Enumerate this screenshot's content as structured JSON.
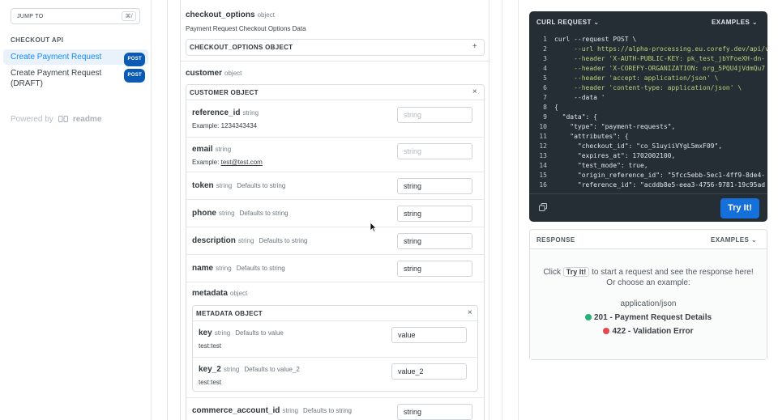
{
  "sidebar": {
    "jump_label": "JUMP TO",
    "jump_shortcut": "⌘/",
    "section": "CHECKOUT API",
    "items": [
      {
        "label": "Create Payment Request",
        "badge": "POST",
        "active": true
      },
      {
        "label": "Create Payment Request (DRAFT)",
        "badge": "POST",
        "active": false
      }
    ],
    "powered_by": "Powered by",
    "powered_brand": "readme"
  },
  "params": {
    "checkout_options": {
      "name": "checkout_options",
      "type": "object",
      "description": "Payment Request Checkout Options Data",
      "object_label": "CHECKOUT_OPTIONS OBJECT",
      "action": "+"
    },
    "customer": {
      "name": "customer",
      "type": "object",
      "object_label": "CUSTOMER OBJECT",
      "action": "×"
    },
    "customer_fields": [
      {
        "name": "reference_id",
        "type": "string",
        "default": "",
        "example_label": "Example:",
        "example": "1234343434",
        "value": "string",
        "placeholder": true
      },
      {
        "name": "email",
        "type": "string",
        "default": "",
        "example_label": "Example:",
        "example": "test@test.com",
        "value": "string",
        "placeholder": true
      },
      {
        "name": "token",
        "type": "string",
        "default": "Defaults to string",
        "value": "string",
        "placeholder": false
      },
      {
        "name": "phone",
        "type": "string",
        "default": "Defaults to string",
        "value": "string",
        "placeholder": false
      },
      {
        "name": "description",
        "type": "string",
        "default": "Defaults to string",
        "value": "string",
        "placeholder": false
      },
      {
        "name": "name",
        "type": "string",
        "default": "Defaults to string",
        "value": "string",
        "placeholder": false
      }
    ],
    "metadata": {
      "name": "metadata",
      "type": "object",
      "object_label": "METADATA OBJECT",
      "action": "×"
    },
    "metadata_fields": [
      {
        "name": "key",
        "type": "string",
        "default": "Defaults to value",
        "note": "test:test",
        "value": "value"
      },
      {
        "name": "key_2",
        "type": "string",
        "default": "Defaults to value_2",
        "note": "test:test",
        "value": "value_2"
      }
    ],
    "commerce_account_id": {
      "name": "commerce_account_id",
      "type": "string",
      "default": "Defaults to string",
      "value": "string"
    }
  },
  "code_panel": {
    "title": "CURL REQUEST",
    "examples": "EXAMPLES",
    "lines": [
      "curl --request POST \\",
      "     --url https://alpha-processing.eu.corefy.dev/api/v",
      "     --header 'X-AUTH-PUBLIC-KEY: pk_test_jbYFoeXH-dn-",
      "     --header 'X-COREFY-ORGANIZATION: org_5PQU4jVdmQu7",
      "     --header 'accept: application/json' \\",
      "     --header 'content-type: application/json' \\",
      "     --data '",
      "{",
      "  \"data\": {",
      "    \"type\": \"payment-requests\",",
      "    \"attributes\": {",
      "      \"checkout_id\": \"co_S1uyiiVYgL5mxF09\",",
      "      \"expires_at\": 1702002100,",
      "      \"test_mode\": true,",
      "      \"origin_reference_id\": \"5fcc5ebb-5ec1-4ff9-8de4-",
      "      \"reference_id\": \"acddb8e5-eea3-4756-9781-19c95ad"
    ],
    "try_label": "Try It!"
  },
  "response_panel": {
    "title": "RESPONSE",
    "examples": "EXAMPLES",
    "msg_before": "Click",
    "msg_kbd": "Try It!",
    "msg_after": "to start a request and see the response here!",
    "msg_line2": "Or choose an example:",
    "content_type": "application/json",
    "examples_list": [
      {
        "code": "201 - Payment Request Details",
        "color": "#27b17a"
      },
      {
        "code": "422 - Validation Error",
        "color": "#e5484d"
      }
    ]
  },
  "colors": {
    "accent": "#118cfd",
    "badge": "#0b5bb5",
    "try_button": "#1670d9",
    "code_bg": "#242e34"
  }
}
